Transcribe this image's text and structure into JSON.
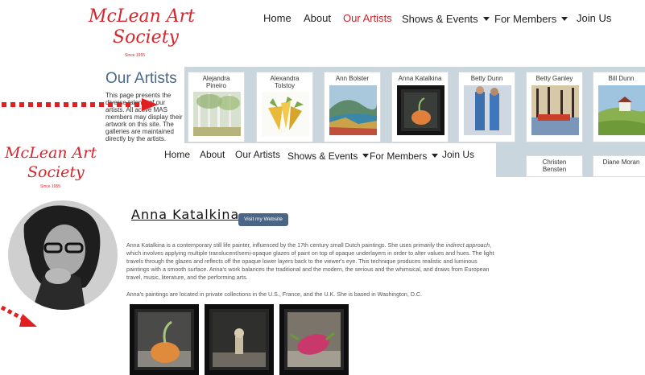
{
  "top_logo": {
    "line1": "McLean Art",
    "line2": "Society",
    "since": "Since 1955"
  },
  "top_nav": {
    "items": [
      "Home",
      "About",
      "Our Artists",
      "Shows & Events",
      "For Members",
      "Join Us"
    ],
    "active": "Our Artists"
  },
  "artists_page": {
    "title": "Our Artists",
    "intro": "This page presents the diverse talents of our artists. All active MAS members may display their artwork on this site. The galleries are maintained directly by the artists.",
    "cards_row1": [
      "Alejandra Pineiro",
      "Alexandra Tolstoy",
      "Ann Bolster",
      "Anna Katalkina",
      "Betty Dunn",
      "Betty Ganley",
      "Bill Dunn"
    ],
    "cards_row2": [
      "Christen Bensten",
      "Diane Moran"
    ]
  },
  "overlay_logo": {
    "line1": "McLean Art",
    "line2": "Society",
    "since": "Since 1955"
  },
  "overlay_nav": {
    "items": [
      "Home",
      "About",
      "Our Artists",
      "Shows & Events",
      "For Members",
      "Join Us"
    ]
  },
  "artist": {
    "name": "Anna Katalkina",
    "website_button": "Visit my Website",
    "bio_p1_a": "Anna Katalkina is a contemporary still life painter, influenced by the 17th century small Dutch paintings. She uses primarily the ",
    "bio_p1_em": "indirect approach",
    "bio_p1_b": ", which involves applying multiple translucent/semi-opaque glazes of paint on top of opaque underlayers in order to alter values and hues. The light travels through the glazes and reflects off the opaque lower layers back to the viewer's eye. This technique produces realistic and luminous paintings with a smooth surface. Anna's work balances the traditional and the modern, the serious and the whimsical, and draws from European travel, music, literature, and the performing arts.",
    "bio_p2": "Anna's paintings are located in private collections in the U.S., France, and the U.K.  She is based in Washington, D.C."
  },
  "colors": {
    "brand_red": "#d6262d",
    "active_nav": "#c8242b",
    "gallery_bg": "#c9d6de",
    "button_bg": "#4a6585",
    "arrow_red": "#e02020"
  }
}
